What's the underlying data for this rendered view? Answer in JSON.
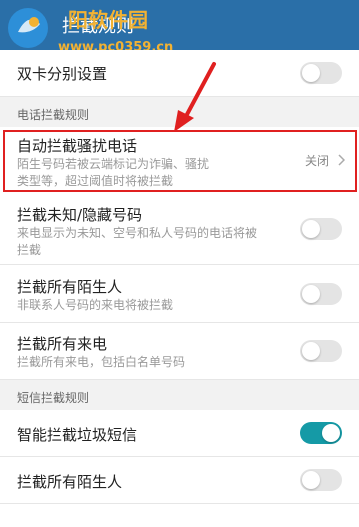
{
  "header": {
    "title": "拦截规则"
  },
  "watermark": {
    "site": "阳软件园",
    "url": "www.pc0359.cn"
  },
  "rows": {
    "dual_sim": {
      "title": "双卡分别设置",
      "on": false
    },
    "auto_block": {
      "title": "自动拦截骚扰电话",
      "desc_line1": "陌生号码若被云端标记为诈骗、骚扰",
      "desc_line2": "类型等，超过阈值时将被拦截",
      "value": "关闭"
    },
    "unknown": {
      "title": "拦截未知/隐藏号码",
      "desc_line1": "来电显示为未知、空号和私人号码的电话将被",
      "desc_line2": "拦截",
      "on": false
    },
    "strangers": {
      "title": "拦截所有陌生人",
      "desc": "非联系人号码的来电将被拦截",
      "on": false
    },
    "all_calls": {
      "title": "拦截所有来电",
      "desc": "拦截所有来电，包括白名单号码",
      "on": false
    },
    "smart_sms": {
      "title": "智能拦截垃圾短信",
      "on": true
    },
    "sms_strangers": {
      "title": "拦截所有陌生人",
      "on": false
    }
  },
  "sections": {
    "call_rules": "电话拦截规则",
    "sms_rules": "短信拦截规则"
  },
  "colors": {
    "titlebar": "#2a6fa8",
    "switch_on": "#159aa6",
    "highlight": "#e02020"
  }
}
